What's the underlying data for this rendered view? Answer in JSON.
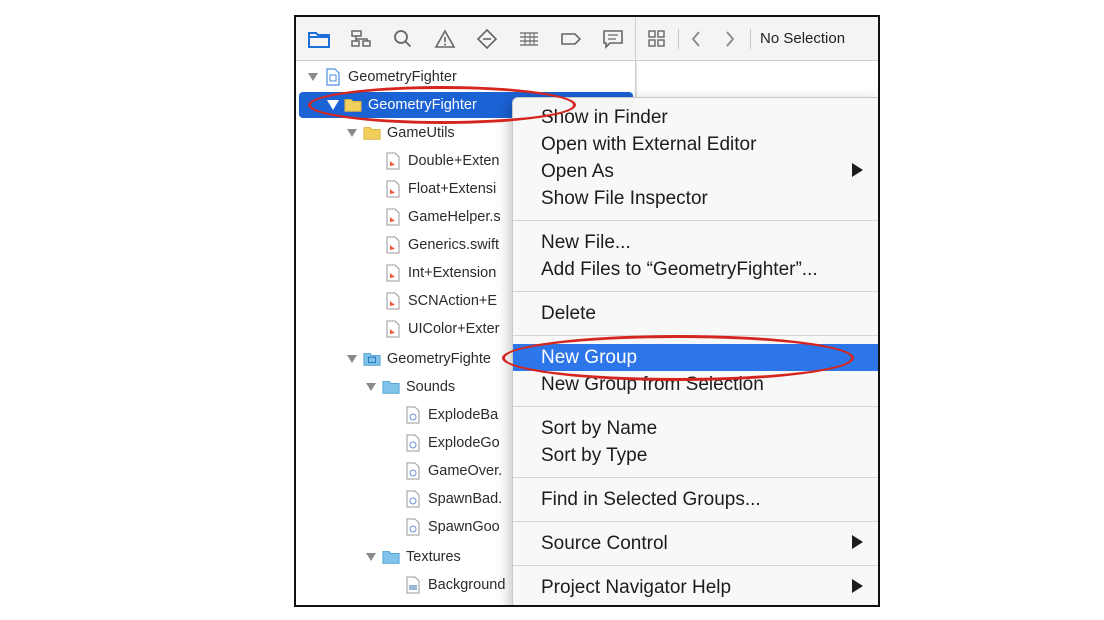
{
  "toolbar": {
    "icons": [
      "folder-icon",
      "hierarchy-icon",
      "search-icon",
      "warning-icon",
      "diamond-icon",
      "table-icon",
      "label-icon",
      "comment-icon"
    ]
  },
  "editor": {
    "no_selection": "No Selection"
  },
  "tree": {
    "project": "GeometryFighter",
    "group_main": "GeometryFighter",
    "game_utils": "GameUtils",
    "files_utils": [
      "Double+Exten",
      "Float+Extensi",
      "GameHelper.s",
      "Generics.swift",
      "Int+Extension",
      "SCNAction+E",
      "UIColor+Exter"
    ],
    "assets_group": "GeometryFighte",
    "sounds": "Sounds",
    "files_sounds": [
      "ExplodeBa",
      "ExplodeGo",
      "GameOver.",
      "SpawnBad.",
      "SpawnGoo"
    ],
    "textures": "Textures",
    "files_textures": [
      "Background"
    ]
  },
  "menu": {
    "show_in_finder": "Show in Finder",
    "open_external": "Open with External Editor",
    "open_as": "Open As",
    "show_inspector": "Show File Inspector",
    "new_file": "New File...",
    "add_files": "Add Files to “GeometryFighter”...",
    "delete": "Delete",
    "new_group": "New Group",
    "new_group_selection": "New Group from Selection",
    "sort_name": "Sort by Name",
    "sort_type": "Sort by Type",
    "find_groups": "Find in Selected Groups...",
    "source_control": "Source Control",
    "nav_help": "Project Navigator Help"
  },
  "colors": {
    "selection": "#1b62d4",
    "menu_highlight": "#2c76ea",
    "annotation": "#d4261f",
    "folder_yellow": "#f2cf5b",
    "folder_blue": "#7fc3ea"
  }
}
